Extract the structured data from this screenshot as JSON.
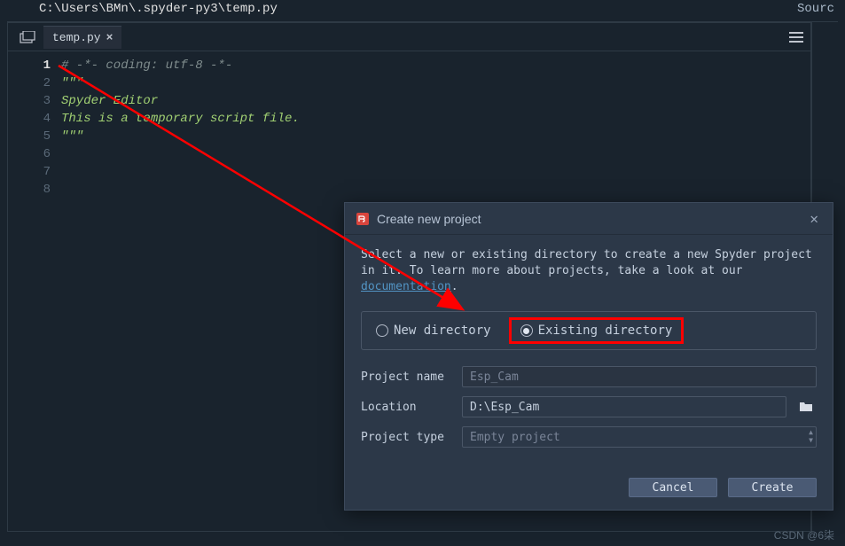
{
  "path": "C:\\Users\\BMn\\.spyder-py3\\temp.py",
  "top_right": "Sourc",
  "tab": {
    "name": "temp.py"
  },
  "lines": [
    "1",
    "2",
    "3",
    "4",
    "5",
    "6",
    "7",
    "8"
  ],
  "code": {
    "l1": "# -*- coding: utf-8 -*-",
    "l2": "\"\"\"",
    "l3": "Spyder Editor",
    "l4": "",
    "l5": "This is a temporary script file.",
    "l6": "\"\"\"",
    "l7": "",
    "l8": ""
  },
  "dialog": {
    "title": "Create new project",
    "desc1": "Select a new or existing directory to create a new Spyder project in it. To learn more about projects, take a look at our ",
    "doc_link": "documentation",
    "radio_new": "New directory",
    "radio_existing": "Existing directory",
    "label_name": "Project name",
    "label_location": "Location",
    "label_type": "Project type",
    "val_name": "Esp_Cam",
    "val_location": "D:\\Esp_Cam",
    "val_type": "Empty project",
    "btn_cancel": "Cancel",
    "btn_create": "Create"
  },
  "watermark": "CSDN @6柒"
}
